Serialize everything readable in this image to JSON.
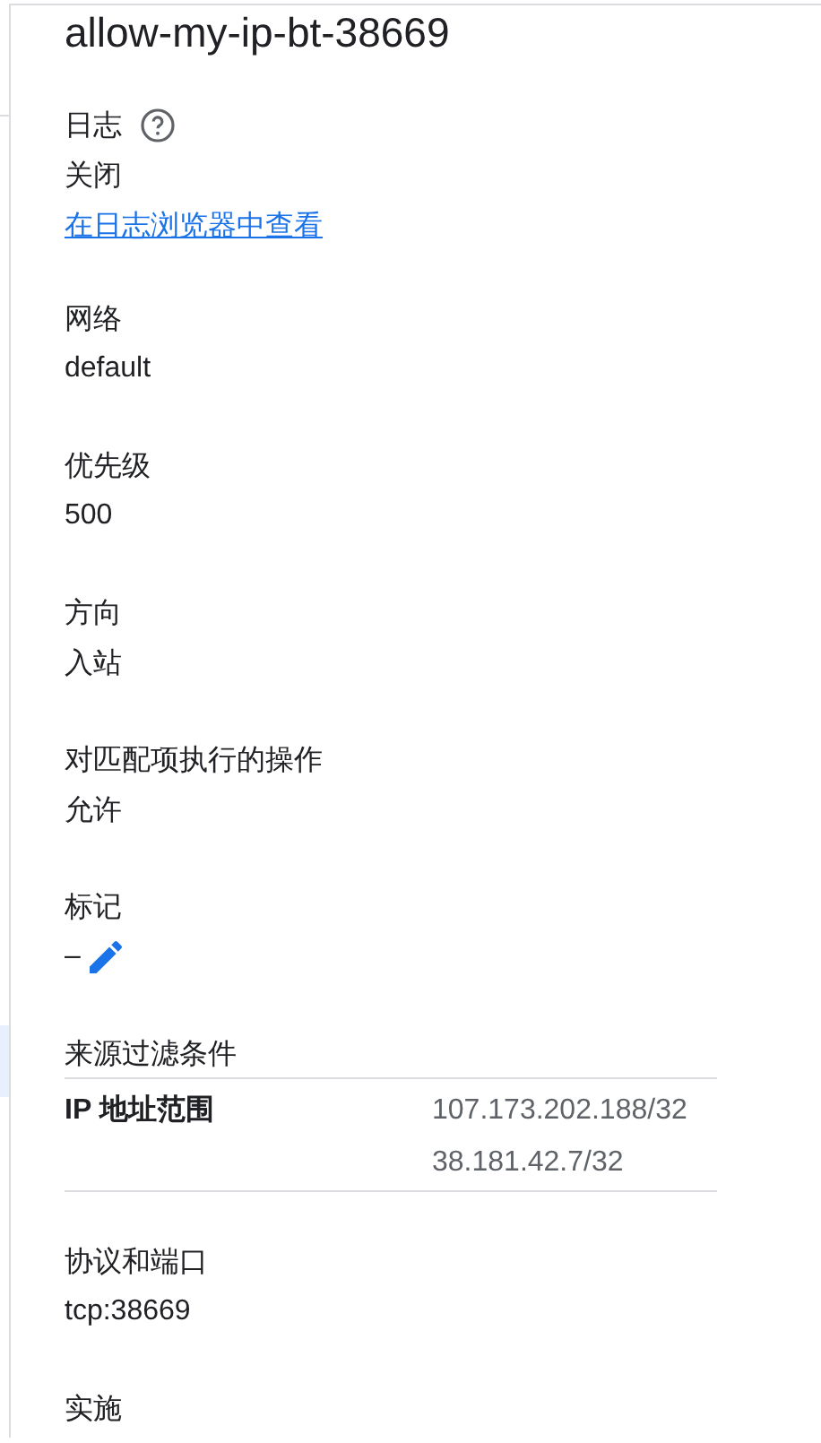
{
  "title": "allow-my-ip-bt-38669",
  "sections": [
    {
      "kind": "field",
      "label": "日志",
      "help": true,
      "value": "关闭",
      "link": "在日志浏览器中查看"
    },
    {
      "kind": "field",
      "label": "网络",
      "value": "default"
    },
    {
      "kind": "field",
      "label": "优先级",
      "value": "500"
    },
    {
      "kind": "field",
      "label": "方向",
      "value": "入站"
    },
    {
      "kind": "field",
      "label": "对匹配项执行的操作",
      "value": "允许"
    },
    {
      "kind": "field",
      "label": "标记",
      "value": "–",
      "editable": true
    },
    {
      "kind": "table",
      "label": "来源过滤条件",
      "rows": [
        {
          "name": "IP 地址范围",
          "values": [
            "107.173.202.188/32",
            "38.181.42.7/32"
          ]
        }
      ]
    },
    {
      "kind": "field",
      "label": "协议和端口",
      "value": "tcp:38669"
    },
    {
      "kind": "field",
      "label": "实施"
    }
  ]
}
